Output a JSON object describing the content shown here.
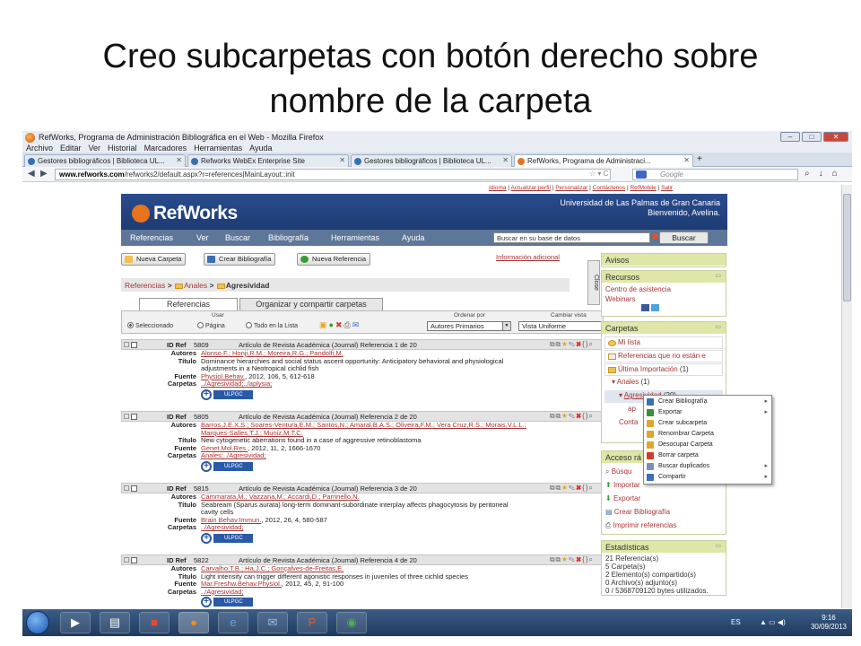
{
  "slide": {
    "title_line1": "Creo subcarpetas con botón derecho sobre",
    "title_line2": "nombre de la carpeta"
  },
  "browser": {
    "window_title": "RefWorks, Programa de Administración Bibliográfica en el Web - Mozilla Firefox",
    "menus": [
      "Archivo",
      "Editar",
      "Ver",
      "Historial",
      "Marcadores",
      "Herramientas",
      "Ayuda"
    ],
    "tabs": [
      {
        "label": "Gestores bibliográficos | Biblioteca UL..."
      },
      {
        "label": "Refworks WebEx Enterprise Site"
      },
      {
        "label": "Gestores bibliográficos | Biblioteca UL..."
      },
      {
        "label": "RefWorks, Programa de Administraci..."
      }
    ],
    "url_host": "www.refworks.com",
    "url_path": "/refworks2/default.aspx?r=references|MainLayout::init",
    "search_placeholder": "Google"
  },
  "refworks": {
    "top_links": [
      "Idioma",
      "Actualizar perfil",
      "Personalizar",
      "Contáctenos",
      "RefMobile",
      "Salir"
    ],
    "logo": "RefWorks",
    "university": "Universidad de Las Palmas de Gran Canaria",
    "welcome": "Bienvenido, Avelina.",
    "menu": [
      "Referencias",
      "Ver",
      "Buscar",
      "Bibliografía",
      "Herramientas",
      "Ayuda"
    ],
    "search_value": "Buscar en su base de datos",
    "search_button": "Buscar",
    "buttons": {
      "nueva_carpeta": "Nueva Carpeta",
      "crear_bibliografia": "Crear Bibliografía",
      "nueva_referencia": "Nueva Referencia"
    },
    "info_link": "Información adicional",
    "breadcrumb": {
      "root": "Referencias",
      "sep": ">",
      "parent": "Anales",
      "current": "Agresividad"
    },
    "ref_tabs": [
      "Referencias",
      "Organizar y compartir carpetas"
    ],
    "toolbar": {
      "usar_label": "Usar",
      "radio_selected": "Seleccionado",
      "radio_page": "Página",
      "radio_all": "Todo en la Lista",
      "order_label": "Ordenar por",
      "order_value": "Autores Primarios",
      "view_label": "Cambiar vista",
      "view_value": "Vista Uniforme"
    },
    "field_labels": {
      "autores": "Autores",
      "titulo": "Título",
      "fuente": "Fuente",
      "carpetas": "Carpetas"
    },
    "id_label": "ID Ref",
    "ulpgc_label": "ULPGC",
    "references": [
      {
        "id": "5809",
        "type": "Artículo de Revista Académica (Journal) Referencia 1 de 20",
        "authors": "Alonso,F.; Honji,R.M.; Moreira,R.G.; Pandolfi,M.",
        "title_lines": [
          "Dominance hierarchies and social status ascent opportunity: Anticipatory behavioral and physiological",
          "adjustments in a Neotropical cichlid fish"
        ],
        "source_link": "Physiol.Behav.",
        "source_rest": ", 2012, 106, 5, 612-618",
        "folders": "../Agresividad;../aplysia;"
      },
      {
        "id": "5805",
        "type": "Artículo de Revista Académica (Journal) Referencia 2 de 20",
        "authors": "Barros,J.E.X.S.; Soares-Ventura,E.M.; Santos,N.; Amaral,B.A.S.; Oliveira,F.M.; Vera Cruz,R.S.; Morais,V.L.L.;",
        "authors2": "Marques-Salles,T.J.; Muniz,M.T.C.",
        "title_lines": [
          "New cytogenetic aberrations found in a case of aggressive retinoblastoma"
        ],
        "source_link": "Genet.Mol.Res.",
        "source_rest": ", 2012, 11, 2, 1666-1670",
        "folders": "Anales;../Agresividad;"
      },
      {
        "id": "5815",
        "type": "Artículo de Revista Académica (Journal) Referencia 3 de 20",
        "authors": "Cammarata,M.; Vazzana,M.; Accardi,D.; Parrinello,N.",
        "title_lines": [
          "Seabream (Sparus aurata) long-term dominant-subordinate interplay affects phagocytosis by peritoneal",
          "cavity cells"
        ],
        "source_link": "Brain Behav.Immun.",
        "source_rest": ", 2012, 26, 4, 580-587",
        "folders": "../Agresividad;"
      },
      {
        "id": "5822",
        "type": "Artículo de Revista Académica (Journal) Referencia 4 de 20",
        "authors": "Carvalho,T.B.; Ha,J.C.; Gonçalves-de-Freitas,E.",
        "title_lines": [
          "Light intensity can trigger different agonistic responses in juveniles of three cichlid species"
        ],
        "source_link": "Mar.Freshw.Behav.Physiol.",
        "source_rest": ", 2012, 45, 2, 91-100",
        "folders": "../Agresividad;"
      }
    ],
    "close_tab": "Close",
    "panels": {
      "avisos": "Avisos",
      "recursos": "Recursos",
      "recursos_links": [
        "Centro de asistencia",
        "Webinars"
      ],
      "carpetas": "Carpetas",
      "folders": [
        {
          "label": "Mi lista"
        },
        {
          "label": "Referencias que no están e"
        },
        {
          "label": "Última Importación",
          "count": "(1)"
        },
        {
          "label": "Anales",
          "count": "(1)"
        },
        {
          "label": "Agresividad",
          "count": "(20)"
        },
        {
          "label": "ap"
        },
        {
          "label": "Conta"
        }
      ],
      "acceso": "Acceso rá",
      "acceso_items": [
        "Búsqu",
        "Importar",
        "Exportar",
        "Crear Bibliografía",
        "Imprimir referencias"
      ],
      "estadisticas": "Estadísticas",
      "stats": [
        "21 Referencia(s)",
        "5 Carpeta(s)",
        "2 Elemento(s) compartido(s)",
        "0 Archivo(s) adjunto(s)",
        "0 / 5368709120 bytes utilizados."
      ]
    },
    "context_menu": [
      {
        "label": "Crear Bibliografía",
        "sub": true,
        "color": "#3b6fb6"
      },
      {
        "label": "Exportar",
        "sub": true,
        "color": "#3a8f3a"
      },
      {
        "label": "Crear subcarpeta",
        "sub": false,
        "color": "#e0a52a"
      },
      {
        "label": "Renombrar Carpeta",
        "sub": false,
        "color": "#e0a52a"
      },
      {
        "label": "Desocupar Carpeta",
        "sub": false,
        "color": "#e0a52a"
      },
      {
        "label": "Borrar carpeta",
        "sub": false,
        "color": "#d23b2b"
      },
      {
        "label": "Buscar duplicados",
        "sub": true,
        "color": "#7a8fb8"
      },
      {
        "label": "Compartir",
        "sub": true,
        "color": "#3b6fb6"
      }
    ]
  },
  "taskbar": {
    "lang": "ES",
    "time": "9:16",
    "date": "30/09/2013"
  }
}
